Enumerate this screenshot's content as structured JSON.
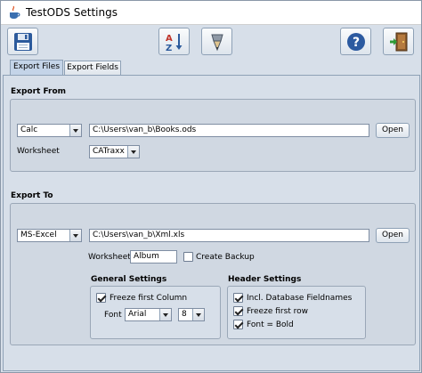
{
  "window": {
    "title": "TestODS Settings"
  },
  "toolbar": {
    "icons": [
      "floppy-save-icon",
      "sort-az-icon",
      "pencil-tip-icon",
      "help-icon",
      "exit-door-icon"
    ],
    "sort_text": "AZ"
  },
  "tabs": [
    {
      "label": "Export Files",
      "active": true
    },
    {
      "label": "Export Fields",
      "active": false
    }
  ],
  "export_from": {
    "title": "Export From",
    "source_type": "Calc",
    "path": "C:\\Users\\van_b\\Books.ods",
    "open_label": "Open",
    "worksheet_label": "Worksheet",
    "worksheet_value": "CATraxx"
  },
  "export_to": {
    "title": "Export To",
    "target_type": "MS-Excel",
    "path": "C:\\Users\\van_b\\Xml.xls",
    "open_label": "Open",
    "worksheet_label": "Worksheet",
    "worksheet_value": "Album",
    "create_backup_label": "Create Backup",
    "create_backup_checked": false
  },
  "general_settings": {
    "title": "General Settings",
    "freeze_first_column_label": "Freeze first Column",
    "freeze_first_column_checked": true,
    "font_label": "Font",
    "font_value": "Arial",
    "font_size_value": "8"
  },
  "header_settings": {
    "title": "Header Settings",
    "options": [
      {
        "label": "Incl. Database Fieldnames",
        "checked": true
      },
      {
        "label": "Freeze first row",
        "checked": true
      },
      {
        "label": "Font = Bold",
        "checked": true
      }
    ]
  }
}
